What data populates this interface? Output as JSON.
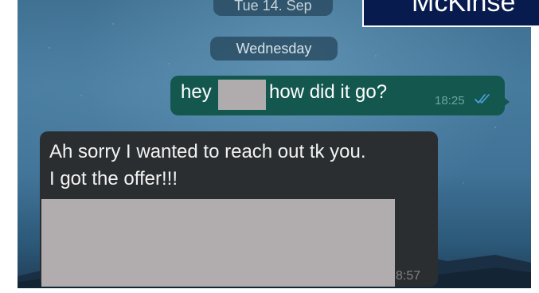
{
  "brand": {
    "logo_text": "McKinse"
  },
  "date_separators": {
    "previous": "Tue 14. Sep",
    "current": "Wednesday"
  },
  "messages": [
    {
      "direction": "outgoing",
      "text_before": "hey",
      "text_after": "how did it go?",
      "time": "18:25",
      "status": "read",
      "status_icon": "double-check-icon"
    },
    {
      "direction": "incoming",
      "line1": "Ah sorry I wanted to reach out tk you.",
      "line2": "I got the offer!!!",
      "time": "8:57"
    }
  ],
  "colors": {
    "outgoing_bubble": "#13574f",
    "incoming_bubble": "#2b2e31",
    "redaction": "#b0acad",
    "read_ticks": "#4fa3e0",
    "brand_bg": "#071b4e"
  }
}
